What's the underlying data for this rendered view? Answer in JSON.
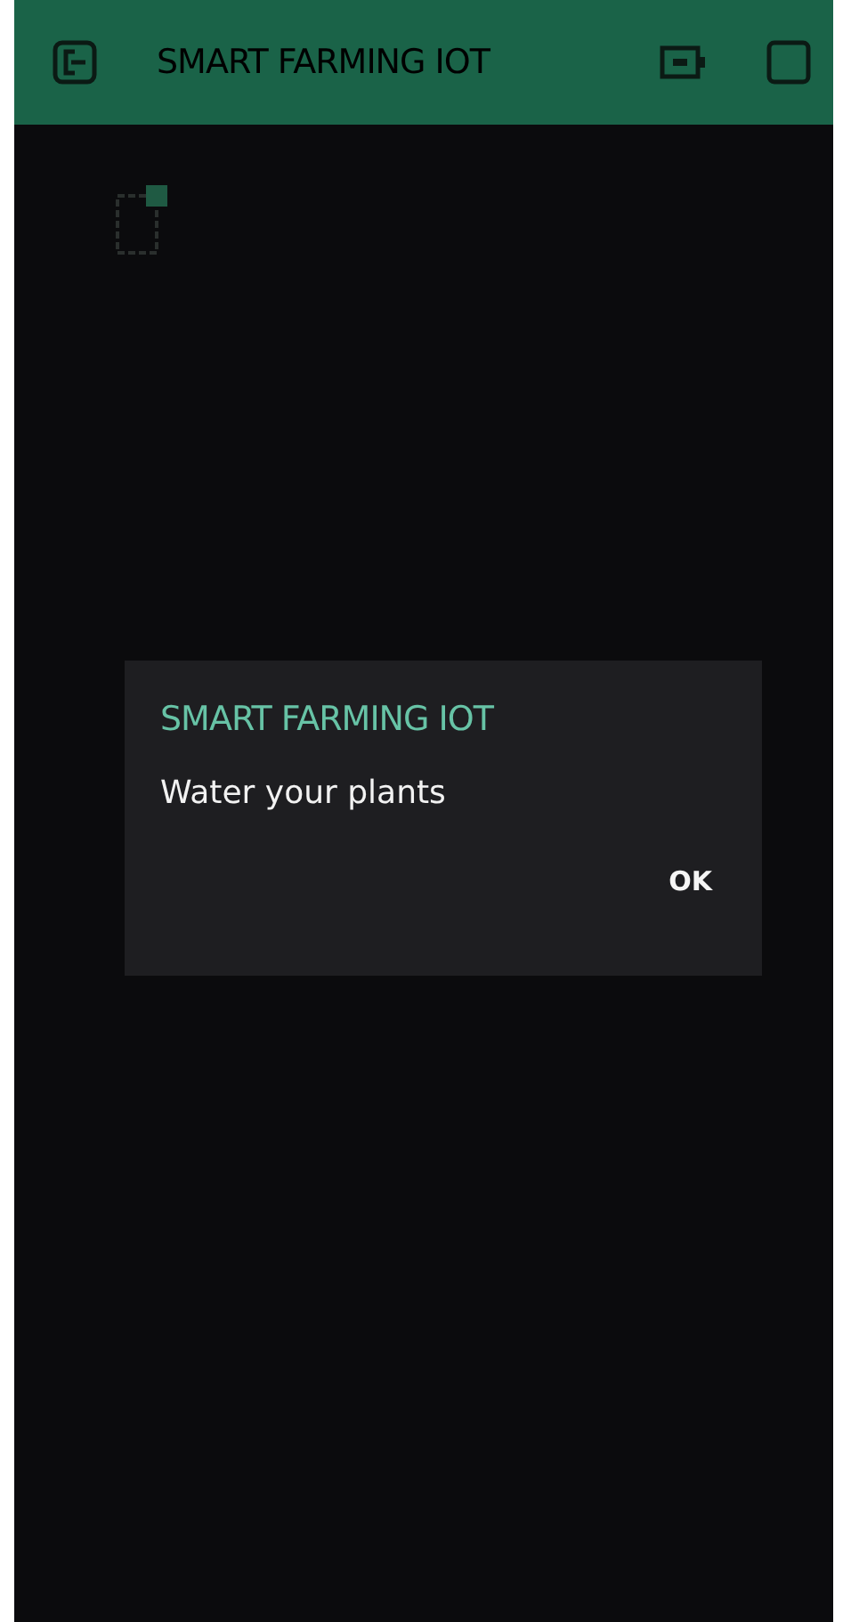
{
  "app_bar": {
    "title": "SMART FARMING IOT"
  },
  "dialog": {
    "title": "SMART FARMING IOT",
    "message": "Water your plants",
    "buttons": [
      "OK"
    ]
  }
}
